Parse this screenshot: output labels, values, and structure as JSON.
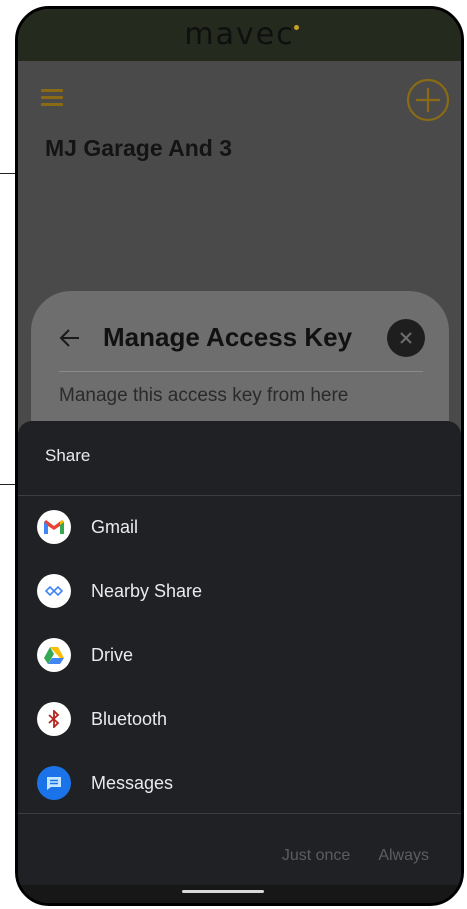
{
  "app": {
    "logo_text": "mavec",
    "brand_color": "#c9a12a",
    "page_title": "MJ Garage And 3"
  },
  "access_sheet": {
    "title": "Manage Access Key",
    "description": "Manage this access key from here"
  },
  "share": {
    "title": "Share",
    "items": [
      {
        "label": "Gmail",
        "icon": "gmail-icon"
      },
      {
        "label": "Nearby Share",
        "icon": "nearby-share-icon"
      },
      {
        "label": "Drive",
        "icon": "drive-icon"
      },
      {
        "label": "Bluetooth",
        "icon": "bluetooth-icon"
      },
      {
        "label": "Messages",
        "icon": "messages-icon"
      }
    ],
    "actions": {
      "just_once": "Just once",
      "always": "Always"
    }
  }
}
